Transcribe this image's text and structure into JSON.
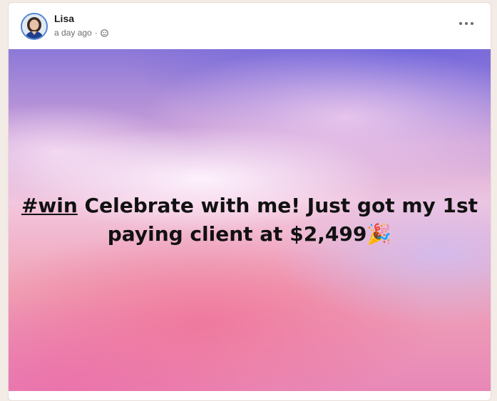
{
  "post": {
    "author": "Lisa",
    "time": "a day ago",
    "separator": "·",
    "hashtag": "#win",
    "line1_rest": " Celebrate with me! Just got my 1st",
    "line2": "paying client at $2,499",
    "emoji": "🎉"
  },
  "icons": {
    "visibility": "globe-icon",
    "menu": "more-options-icon"
  },
  "colors": {
    "avatar_ring": "#4f83d4",
    "background": "#f3ebe6"
  }
}
